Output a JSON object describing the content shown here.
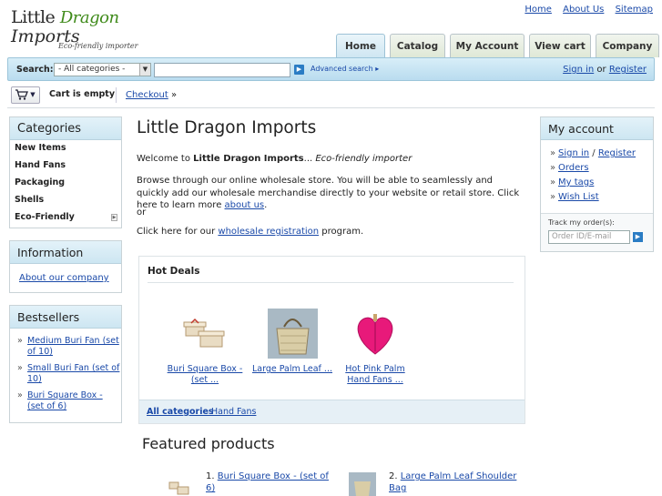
{
  "header": {
    "logo_line1": "Little",
    "logo_line1b": "Dragon",
    "logo_line2": "Imports",
    "logo_tagline": "Eco-friendly importer",
    "top_links": [
      "Home",
      "About Us",
      "Sitemap"
    ]
  },
  "tabs": [
    {
      "label": "Home",
      "active": true
    },
    {
      "label": "Catalog",
      "active": false
    },
    {
      "label": "My Account",
      "active": false
    },
    {
      "label": "View cart",
      "active": false
    },
    {
      "label": "Company",
      "active": false
    }
  ],
  "search": {
    "label": "Search:",
    "category_selected": "- All categories -",
    "query": "",
    "advanced_label": "Advanced search",
    "signin": "Sign in",
    "or": "or",
    "register": "Register"
  },
  "cart": {
    "status": "Cart is empty",
    "checkout_label": "Checkout"
  },
  "categories": {
    "title": "Categories",
    "items": [
      "New Items",
      "Hand Fans",
      "Packaging",
      "Shells",
      "Eco-Friendly"
    ]
  },
  "information": {
    "title": "Information",
    "link": "About our company"
  },
  "bestsellers": {
    "title": "Bestsellers",
    "items": [
      "Medium Buri Fan (set of 10)",
      "Small Buri Fan (set of 10)",
      "Buri Square Box - (set of 6)"
    ]
  },
  "account": {
    "title": "My account",
    "signin": "Sign in",
    "slash": "/",
    "register": "Register",
    "links": [
      "Orders",
      "My tags",
      "Wish List"
    ],
    "track_label": "Track my order(s):",
    "track_placeholder": "Order ID/E-mail"
  },
  "main": {
    "title": "Little Dragon Imports",
    "welcome_prefix": "Welcome to ",
    "welcome_bold": "Little Dragon Imports",
    "welcome_mid": "... ",
    "welcome_italic": "Eco-friendly importer",
    "browse_text": "Browse through our online wholesale store. You will be able to seamlessly and quickly add our wholesale merchandise directly to your website or retail store. Click here to learn more ",
    "about_link": "about us",
    "browse_end": ".",
    "or": "or",
    "reg_prefix": "Click here for our ",
    "reg_link": "wholesale registration",
    "reg_suffix": " program."
  },
  "hot_deals": {
    "title": "Hot Deals",
    "items": [
      {
        "line1": "Buri Square Box -",
        "line2": "(set ..."
      },
      {
        "line1": "Large Palm Leaf ...",
        "line2": ""
      },
      {
        "line1": "Hot Pink Palm",
        "line2": "Hand Fans ..."
      }
    ],
    "link_all": "All categories",
    "link_fans": "Hand Fans"
  },
  "featured": {
    "title": "Featured products",
    "items": [
      {
        "num": "1.",
        "line1": "Buri Square Box - (set of",
        "line2": "6)"
      },
      {
        "num": "2.",
        "line1": "Large Palm Leaf Shoulder",
        "line2": "Bag"
      }
    ]
  },
  "colors": {
    "link": "#1a49a8",
    "accent_blue": "#cde6f2",
    "logo_green": "#3f8a1a"
  }
}
